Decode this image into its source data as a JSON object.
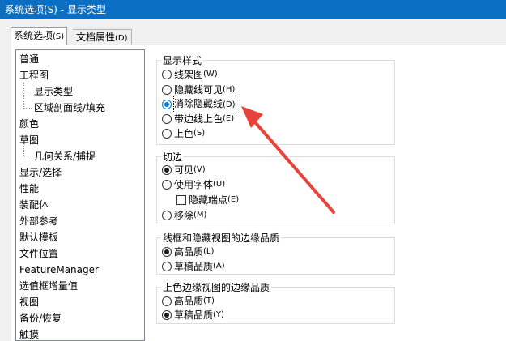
{
  "window": {
    "title": "系统选项(S) - 显示类型"
  },
  "tabs": [
    {
      "label": "系统选项",
      "hotkey": "(S)"
    },
    {
      "label": "文档属性",
      "hotkey": "(D)"
    }
  ],
  "tree": {
    "items": [
      "普通",
      "工程图",
      "显示类型",
      "区域剖面线/填充",
      "颜色",
      "草图",
      "几何关系/捕捉",
      "显示/选择",
      "性能",
      "装配体",
      "外部参考",
      "默认模板",
      "文件位置",
      "FeatureManager",
      "选值框增量值",
      "视图",
      "备份/恢复",
      "触摸"
    ]
  },
  "display_style": {
    "legend": "显示样式",
    "options": [
      {
        "label": "线架图",
        "hotkey": "(W)"
      },
      {
        "label": "隐藏线可见",
        "hotkey": "(H)"
      },
      {
        "label": "消除隐藏线",
        "hotkey": "(D)"
      },
      {
        "label": "带边线上色",
        "hotkey": "(E)"
      },
      {
        "label": "上色",
        "hotkey": "(S)"
      }
    ],
    "selected": "消除隐藏线"
  },
  "tangent_edges": {
    "legend": "切边",
    "options": [
      {
        "label": "可见",
        "hotkey": "(V)"
      },
      {
        "label": "使用字体",
        "hotkey": "(U)"
      },
      {
        "label": "移除",
        "hotkey": "(M)"
      }
    ],
    "checkbox": {
      "label": "隐藏端点",
      "hotkey": "(E)",
      "checked": false
    },
    "selected": "可见"
  },
  "wireframe_quality": {
    "legend": "线框和隐藏视图的边缘品质",
    "options": [
      {
        "label": "高品质",
        "hotkey": "(L)"
      },
      {
        "label": "草稿品质",
        "hotkey": "(A)"
      }
    ],
    "selected": "高品质"
  },
  "shaded_quality": {
    "legend": "上色边缘视图的边缘品质",
    "options": [
      {
        "label": "高品质",
        "hotkey": "(T)"
      },
      {
        "label": "草稿品质",
        "hotkey": "(Y)"
      }
    ],
    "selected": "草稿品质"
  },
  "colors": {
    "titlebar": "#0a6fc2",
    "annotation_arrow": "#e8423a",
    "radio_focus": "#0078d7"
  }
}
